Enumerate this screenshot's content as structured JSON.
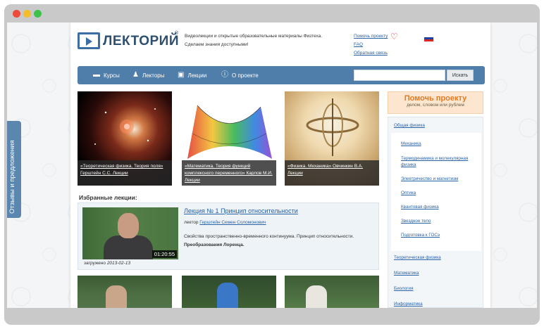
{
  "side_tab": {
    "label": "Отзывы и предложения"
  },
  "header": {
    "logo_text": "ЛЕКТОРИЙ",
    "logo_reg": "®",
    "tagline_line1": "Видеолекции и открытые образовательные материалы Физтеха.",
    "tagline_line2": "Сделаем знания доступными!",
    "links": {
      "help": "Помочь проекту",
      "faq": "FAQ",
      "feedback": "Обратная связь"
    },
    "flag_colors": [
      "#ffffff",
      "#1c3fa8",
      "#d52b1e"
    ]
  },
  "nav": {
    "items": [
      {
        "label": "Курсы",
        "icon": "monitor-icon"
      },
      {
        "label": "Лекторы",
        "icon": "person-icon"
      },
      {
        "label": "Лекции",
        "icon": "video-icon"
      },
      {
        "label": "О проекте",
        "icon": "info-icon"
      }
    ],
    "search_placeholder": "",
    "search_button": "Искать"
  },
  "featured": [
    {
      "caption": "«Теоретическая физика. Теория поля» Герштейн С.С. Лекции"
    },
    {
      "caption": "«Математика. Теория функций комплексного переменного» Карлов М.И. Лекции"
    },
    {
      "caption": "«Физика. Механика» Овчинкин В.А. Лекции"
    }
  ],
  "favorites": {
    "title": "Избранные лекции:",
    "lecture": {
      "title": "Лекция № 1 Принцип относительности",
      "lecturer_label": "лектор",
      "lecturer_name": "Герштейн Семен Соломонович",
      "desc_line1": "Свойства пространственно-временного континуума. Принцип относительности.",
      "desc_line2": "Преобразования Лоренца.",
      "duration": "01:20:55",
      "uploaded_label": "загружено",
      "uploaded_date": "2013-02-13"
    }
  },
  "sidebar": {
    "help_title": "Помочь проекту",
    "help_sub": "делом, словом или рублем",
    "categories": [
      {
        "label": "Общая физика",
        "level": 0
      },
      {
        "label": "Механика",
        "level": 1
      },
      {
        "label": "Термодинамика и молекулярная физика",
        "level": 1
      },
      {
        "label": "Электричество и магнетизм",
        "level": 1
      },
      {
        "label": "Оптика",
        "level": 1
      },
      {
        "label": "Квантовая физика",
        "level": 1
      },
      {
        "label": "Звездное тело",
        "level": 1
      },
      {
        "label": "Подготовка к ГОСэ",
        "level": 1
      },
      {
        "label": "Теоретическая физика",
        "level": 0
      },
      {
        "label": "Математика",
        "level": 0
      },
      {
        "label": "Биология",
        "level": 0
      },
      {
        "label": "Информатика",
        "level": 0
      }
    ]
  },
  "colors": {
    "nav_bg": "#4f7eaa",
    "link": "#2a62a6",
    "help_accent": "#e07b24"
  }
}
